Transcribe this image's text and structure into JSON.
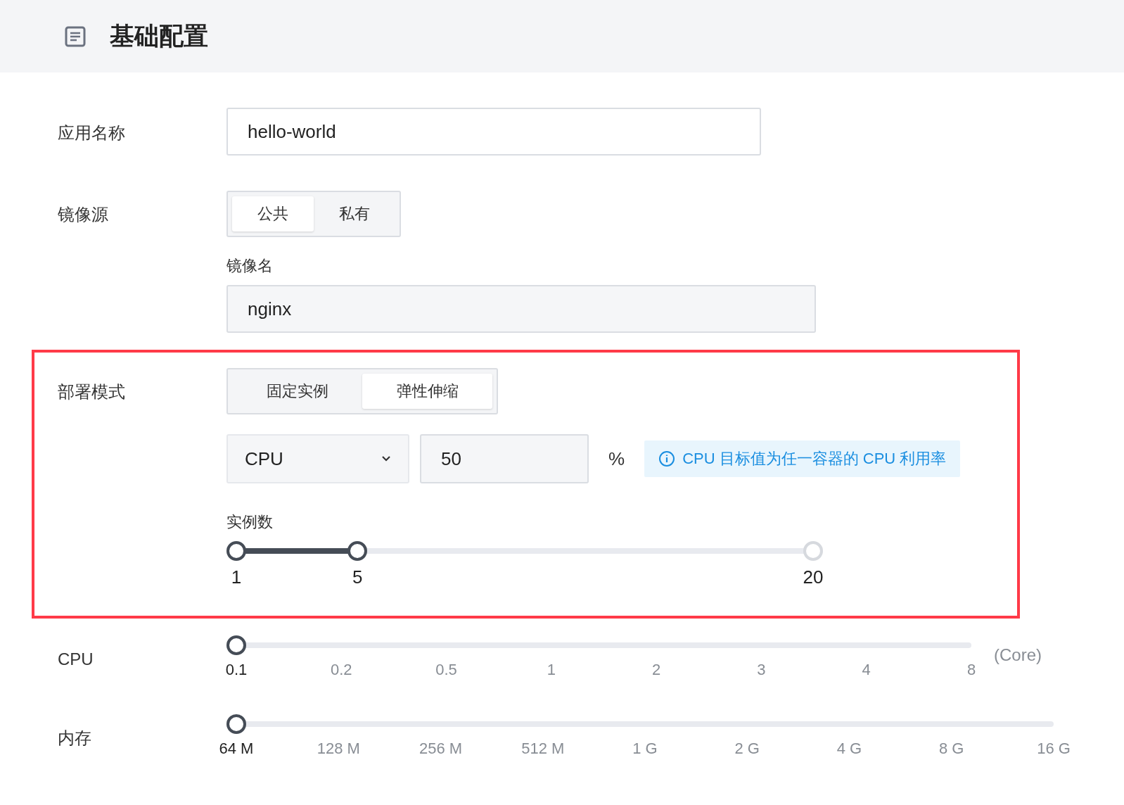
{
  "header": {
    "title": "基础配置"
  },
  "app_name": {
    "label": "应用名称",
    "value": "hello-world"
  },
  "image_source": {
    "label": "镜像源",
    "options": [
      {
        "label": "公共",
        "selected": true
      },
      {
        "label": "私有",
        "selected": false
      }
    ],
    "image_name": {
      "label": "镜像名",
      "value": "nginx"
    }
  },
  "deploy_mode": {
    "label": "部署模式",
    "highlighted": true,
    "options": [
      {
        "label": "固定实例",
        "selected": false
      },
      {
        "label": "弹性伸缩",
        "selected": true
      }
    ],
    "metric": {
      "value": "CPU"
    },
    "target": {
      "value": "50"
    },
    "unit": "%",
    "hint": "CPU 目标值为任一容器的 CPU 利用率",
    "instances": {
      "label": "实例数",
      "thumbs": [
        {
          "level": 0,
          "label": "1"
        },
        {
          "level": 0.21,
          "label": "5"
        }
      ],
      "max_label": "20"
    }
  },
  "cpu": {
    "label": "CPU",
    "level": 0,
    "unit": "(Core)",
    "ticks": [
      {
        "label": "0.1",
        "selected": true
      },
      {
        "label": "0.2",
        "selected": false
      },
      {
        "label": "0.5",
        "selected": false
      },
      {
        "label": "1",
        "selected": false
      },
      {
        "label": "2",
        "selected": false
      },
      {
        "label": "3",
        "selected": false
      },
      {
        "label": "4",
        "selected": false
      },
      {
        "label": "8",
        "selected": false
      }
    ]
  },
  "memory": {
    "label": "内存",
    "level": 0,
    "ticks": [
      {
        "label": "64 M",
        "selected": true
      },
      {
        "label": "128 M",
        "selected": false
      },
      {
        "label": "256 M",
        "selected": false
      },
      {
        "label": "512 M",
        "selected": false
      },
      {
        "label": "1 G",
        "selected": false
      },
      {
        "label": "2 G",
        "selected": false
      },
      {
        "label": "4 G",
        "selected": false
      },
      {
        "label": "8 G",
        "selected": false
      },
      {
        "label": "16 G",
        "selected": false
      }
    ]
  }
}
